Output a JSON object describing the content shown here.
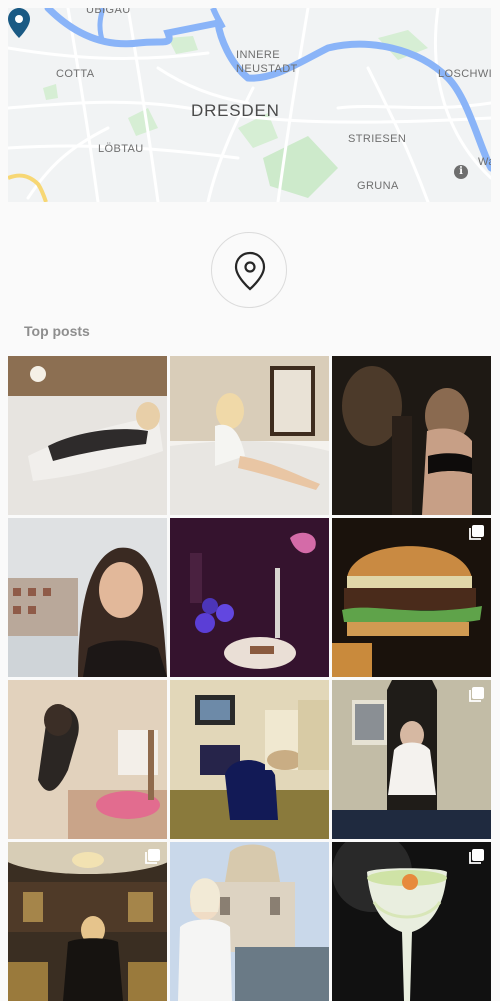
{
  "map": {
    "labels": {
      "ubigau": "UBIGAU",
      "cotta": "COTTA",
      "innere": "INNERE",
      "neustadt": "NEUSTADT",
      "city": "DRESDEN",
      "loschwitz": "LOSCHWI",
      "lobtau": "LÖBTAU",
      "striesen": "STRIESEN",
      "gruna": "GRUNA",
      "edge": "Wa"
    },
    "info_glyph": "i",
    "pin_icon": "map-pin-icon",
    "colors": {
      "water": "#8ab4f8",
      "park": "#cdeacb",
      "pin": "#1a5a84",
      "road": "#ffffff",
      "highway": "#f7d774"
    }
  },
  "location": {
    "icon": "location-pin-icon"
  },
  "sections": {
    "top_posts": "Top posts"
  },
  "posts": [
    {
      "subject": "hotel bed portrait",
      "multi": false
    },
    {
      "subject": "hotel bed portrait",
      "multi": false
    },
    {
      "subject": "dark room portrait",
      "multi": false
    },
    {
      "subject": "window city portrait",
      "multi": false
    },
    {
      "subject": "flowers and plate",
      "multi": false
    },
    {
      "subject": "burger",
      "multi": true
    },
    {
      "subject": "mirror selfie",
      "multi": false
    },
    {
      "subject": "hotel room",
      "multi": false
    },
    {
      "subject": "robe on throne",
      "multi": true
    },
    {
      "subject": "lobby tea",
      "multi": true
    },
    {
      "subject": "city portrait",
      "multi": false
    },
    {
      "subject": "cocktail",
      "multi": true
    }
  ]
}
